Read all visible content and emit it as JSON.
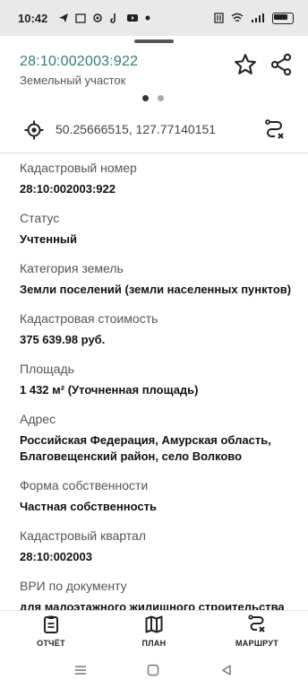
{
  "status_bar": {
    "time": "10:42",
    "notification_icons": [
      "telegram-icon",
      "calendar-icon",
      "settings-icon",
      "tiktok-icon",
      "youtube-icon",
      "dot-icon"
    ],
    "system_icons": [
      "nfc-icon",
      "wifi-icon",
      "signal-icon",
      "battery-icon"
    ]
  },
  "header": {
    "title": "28:10:002003:922",
    "subtitle": "Земельный участок",
    "accent_color": "#2e7d78"
  },
  "pager": {
    "count": 2,
    "active": 0
  },
  "coordinates": {
    "value": "50.25666515, 127.77140151"
  },
  "fields": [
    {
      "label": "Кадастровый номер",
      "value": "28:10:002003:922"
    },
    {
      "label": "Статус",
      "value": "Учтенный"
    },
    {
      "label": "Категория земель",
      "value": "Земли поселений (земли населенных пунктов)"
    },
    {
      "label": "Кадастровая стоимость",
      "value": "375 639.98 руб."
    },
    {
      "label": "Площадь",
      "value": "1 432 м² (Уточненная площадь)"
    },
    {
      "label": "Адрес",
      "value": "Российская Федерация, Амурская область, Благовещенский район, село Волково"
    },
    {
      "label": "Форма собственности",
      "value": "Частная собственность"
    },
    {
      "label": "Кадастровый квартал",
      "value": "28:10:002003"
    },
    {
      "label": "ВРИ по документу",
      "value": "для малоэтажного жилищного строительства"
    }
  ],
  "bottom_nav": [
    {
      "label": "ОТЧЁТ",
      "icon": "report-icon"
    },
    {
      "label": "ПЛАН",
      "icon": "map-icon"
    },
    {
      "label": "МАРШРУТ",
      "icon": "route-icon"
    }
  ]
}
